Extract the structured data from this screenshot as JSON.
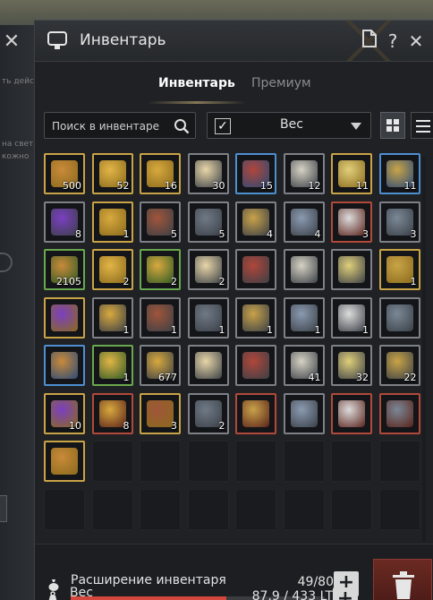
{
  "window": {
    "title": "Инвентарь"
  },
  "background": {
    "left_text_1": "ть действия Диалог",
    "left_text_2": "на светлом тёмную",
    "left_text_3": "кожно"
  },
  "tabs": [
    {
      "label": "Инвентарь",
      "active": true
    },
    {
      "label": "Премиум",
      "active": false
    }
  ],
  "search": {
    "placeholder": "Поиск в инвентаре"
  },
  "sort": {
    "label": "Вес",
    "checked": true
  },
  "inventory": {
    "items": [
      {
        "icon": "catapult-ammo-icon",
        "qty": "500",
        "rarity": "gold"
      },
      {
        "icon": "gold-bar-icon",
        "qty": "52",
        "rarity": "gold"
      },
      {
        "icon": "gold-bars-icon",
        "qty": "16",
        "rarity": "gold"
      },
      {
        "icon": "potion-flask-icon",
        "qty": "30",
        "rarity": "white"
      },
      {
        "icon": "tea-cup-icon",
        "qty": "15",
        "rarity": "blue"
      },
      {
        "icon": "scroll-icon",
        "qty": "12",
        "rarity": "white"
      },
      {
        "icon": "golden-scroll-icon",
        "qty": "11",
        "rarity": "gold"
      },
      {
        "icon": "feather-icon",
        "qty": "11",
        "rarity": "blue"
      },
      {
        "icon": "purple-gem-icon",
        "qty": "8",
        "rarity": "white"
      },
      {
        "icon": "gold-bar-icon",
        "qty": "1",
        "rarity": "gold"
      },
      {
        "icon": "copper-coin-icon",
        "qty": "5",
        "rarity": "white"
      },
      {
        "icon": "chest-icon",
        "qty": "5",
        "rarity": "white"
      },
      {
        "icon": "golden-orb-icon",
        "qty": "4",
        "rarity": "white"
      },
      {
        "icon": "silver-chest-icon",
        "qty": "4",
        "rarity": "white"
      },
      {
        "icon": "white-chest-icon",
        "qty": "3",
        "rarity": "red"
      },
      {
        "icon": "chest-icon",
        "qty": "3",
        "rarity": "white"
      },
      {
        "icon": "vial-icon",
        "qty": "2105",
        "rarity": "green"
      },
      {
        "icon": "red-stone-icon",
        "qty": "2",
        "rarity": "gold"
      },
      {
        "icon": "green-box-icon",
        "qty": "2",
        "rarity": "green"
      },
      {
        "icon": "dark-chest-icon",
        "qty": "2",
        "rarity": "white"
      },
      {
        "icon": "ornate-chest-icon",
        "qty": "",
        "rarity": "white"
      },
      {
        "icon": "blue-crystal-icon",
        "qty": "",
        "rarity": "white"
      },
      {
        "icon": "ice-crystal-icon",
        "qty": "",
        "rarity": "white"
      },
      {
        "icon": "treasure-chest-icon",
        "qty": "1",
        "rarity": "gold"
      },
      {
        "icon": "blue-chest-icon",
        "qty": "",
        "rarity": "gold"
      },
      {
        "icon": "chest-icon",
        "qty": "1",
        "rarity": "white"
      },
      {
        "icon": "red-feather-icon",
        "qty": "1",
        "rarity": "white"
      },
      {
        "icon": "chest-icon",
        "qty": "1",
        "rarity": "white"
      },
      {
        "icon": "golden-chest-icon",
        "qty": "1",
        "rarity": "white"
      },
      {
        "icon": "crystal-cluster-icon",
        "qty": "1",
        "rarity": "white"
      },
      {
        "icon": "ice-crystal-icon",
        "qty": "1",
        "rarity": "white"
      },
      {
        "icon": "jewelry-icon",
        "qty": "",
        "rarity": "white"
      },
      {
        "icon": "gift-bags-icon",
        "qty": "",
        "rarity": "blue"
      },
      {
        "icon": "gift-box-icon",
        "qty": "1",
        "rarity": "green"
      },
      {
        "icon": "blue-orb-icon",
        "qty": "677",
        "rarity": "white"
      },
      {
        "icon": "mushroom-icon",
        "qty": "",
        "rarity": "white"
      },
      {
        "icon": "wolf-head-icon",
        "qty": "",
        "rarity": "white"
      },
      {
        "icon": "amber-orb-icon",
        "qty": "41",
        "rarity": "white"
      },
      {
        "icon": "scroll-icon",
        "qty": "32",
        "rarity": "white"
      },
      {
        "icon": "letter-icon",
        "qty": "22",
        "rarity": "white"
      },
      {
        "icon": "map-scroll-icon",
        "qty": "10",
        "rarity": "gold"
      },
      {
        "icon": "scroll-icon",
        "qty": "8",
        "rarity": "red"
      },
      {
        "icon": "card-icon",
        "qty": "3",
        "rarity": "gold"
      },
      {
        "icon": "blue-tile-icon",
        "qty": "2",
        "rarity": "white"
      },
      {
        "icon": "golden-weapon-icon",
        "qty": "",
        "rarity": "red"
      },
      {
        "icon": "hammer-icon",
        "qty": "",
        "rarity": "white"
      },
      {
        "icon": "red-scroll-icon",
        "qty": "",
        "rarity": "red"
      },
      {
        "icon": "red-book-icon",
        "qty": "",
        "rarity": "red"
      },
      {
        "icon": "purple-scroll-icon",
        "qty": "",
        "rarity": "gold"
      }
    ]
  },
  "expansion": {
    "label": "Расширение инвентаря",
    "value": "49/80",
    "fraction": 0.6125
  },
  "weight": {
    "label": "Вес",
    "value": "87,9 / 433 LT"
  }
}
